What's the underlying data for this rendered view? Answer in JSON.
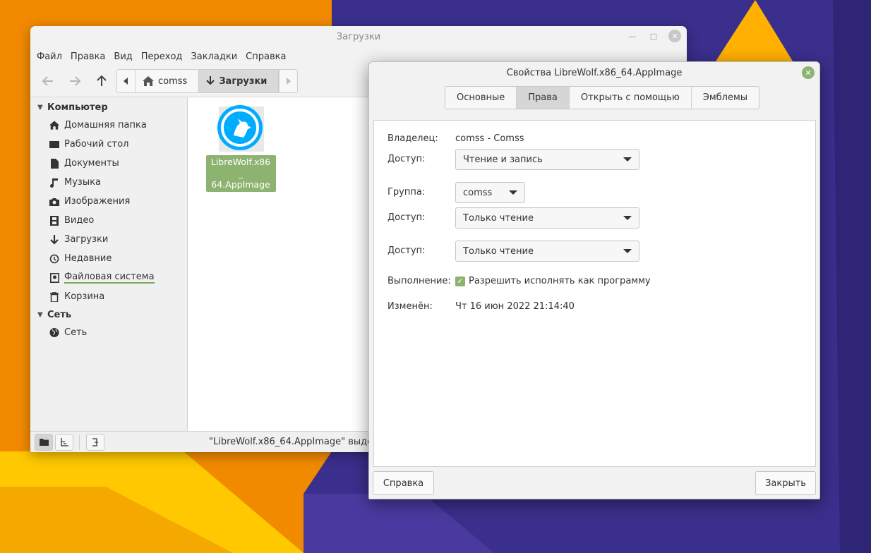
{
  "file_manager": {
    "title": "Загрузки",
    "menu": [
      "Файл",
      "Правка",
      "Вид",
      "Переход",
      "Закладки",
      "Справка"
    ],
    "path": [
      "comss",
      "Загрузки"
    ],
    "sidebar": {
      "computer_header": "Компьютер",
      "items": [
        {
          "label": "Домашняя папка",
          "icon": "home-icon"
        },
        {
          "label": "Рабочий стол",
          "icon": "desktop-icon"
        },
        {
          "label": "Документы",
          "icon": "document-icon"
        },
        {
          "label": "Музыка",
          "icon": "music-icon"
        },
        {
          "label": "Изображения",
          "icon": "camera-icon"
        },
        {
          "label": "Видео",
          "icon": "film-icon"
        },
        {
          "label": "Загрузки",
          "icon": "download-icon"
        },
        {
          "label": "Недавние",
          "icon": "history-icon"
        },
        {
          "label": "Файловая система",
          "icon": "drive-icon"
        },
        {
          "label": "Корзина",
          "icon": "trash-icon"
        }
      ],
      "network_header": "Сеть",
      "network_items": [
        {
          "label": "Сеть",
          "icon": "globe-icon"
        }
      ]
    },
    "file": {
      "name_line1": "LibreWolf.x86_",
      "name_line2": "64.AppImage"
    },
    "status": "\"LibreWolf.x86_64.AppImage\" выдел"
  },
  "dialog": {
    "title": "Свойства LibreWolf.x86_64.AppImage",
    "tabs": [
      "Основные",
      "Права",
      "Открыть с помощью",
      "Эмблемы"
    ],
    "active_tab": "Права",
    "owner_label": "Владелец:",
    "owner_value": "comss - Comss",
    "owner_access_label": "Доступ:",
    "owner_access_value": "Чтение и запись",
    "group_label": "Группа:",
    "group_value": "comss",
    "group_access_label": "Доступ:",
    "group_access_value": "Только чтение",
    "others_access_label": "Доступ:",
    "others_access_value": "Только чтение",
    "exec_label": "Выполнение:",
    "exec_checkbox_label": "Разрешить исполнять как программу",
    "exec_checked": true,
    "modified_label": "Изменён:",
    "modified_value": "Чт 16 июн 2022 21:14:40",
    "help_button": "Справка",
    "close_button": "Закрыть"
  },
  "colors": {
    "accent": "#8cb36f",
    "wallpaper_orange": "#f28a00",
    "wallpaper_purple": "#3a2f8c",
    "wallpaper_yellow": "#ffc500"
  }
}
